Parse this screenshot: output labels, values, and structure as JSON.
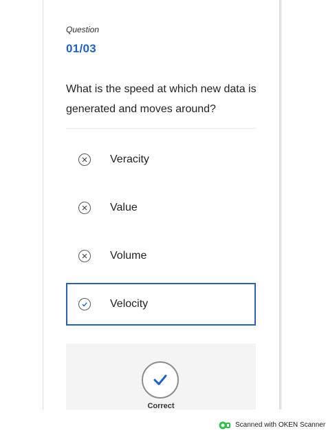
{
  "quiz": {
    "label": "Question",
    "counter": "01/03",
    "question": "What is the speed at which new data is generated and moves around?",
    "options": [
      {
        "label": "Veracity",
        "status": "incorrect"
      },
      {
        "label": "Value",
        "status": "incorrect"
      },
      {
        "label": "Volume",
        "status": "incorrect"
      },
      {
        "label": "Velocity",
        "status": "selected-correct"
      }
    ],
    "feedback": "Correct"
  },
  "scanner": {
    "text": "Scanned with OKEN Scanner"
  },
  "colors": {
    "accent": "#1d62c9",
    "selected_border": "#2a5fb8",
    "feedback_bg": "#f4f4f4",
    "scanner_green": "#2fbf4a"
  },
  "icons": {
    "wrong": "close-circle-icon",
    "right": "check-circle-icon",
    "feedback": "checkmark-icon",
    "scanner": "oken-logo-icon"
  }
}
